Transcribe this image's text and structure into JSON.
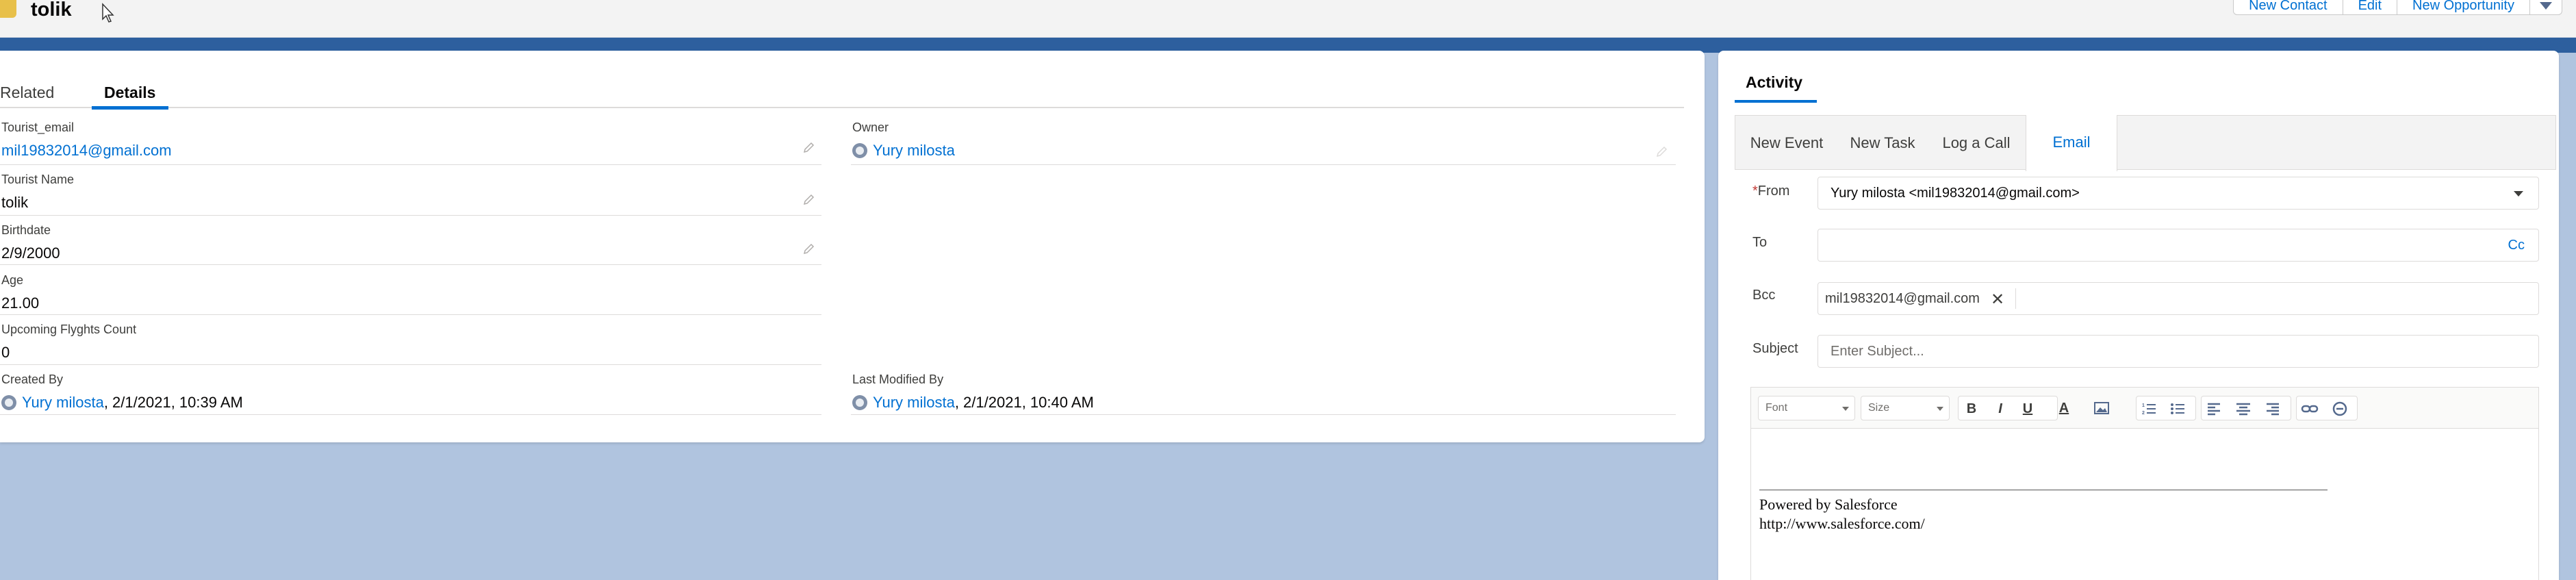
{
  "header": {
    "record_name": "tolik",
    "actions": [
      "New Contact",
      "Edit",
      "New Opportunity"
    ],
    "menu_icon": "chevron-down-icon"
  },
  "detail": {
    "tabs": [
      "Related",
      "Details"
    ],
    "active_tab": "Details",
    "fields": {
      "tourist_email": {
        "label": "Tourist_email",
        "value": "mil19832014@gmail.com"
      },
      "tourist_name": {
        "label": "Tourist Name",
        "value": "tolik"
      },
      "birthdate": {
        "label": "Birthdate",
        "value": "2/9/2000"
      },
      "age": {
        "label": "Age",
        "value": "21.00"
      },
      "upcoming_flights": {
        "label": "Upcoming Flyghts Count",
        "value": "0"
      },
      "owner": {
        "label": "Owner",
        "value": "Yury milosta"
      },
      "created_by": {
        "label": "Created By",
        "user": "Yury milosta",
        "date": ", 2/1/2021, 10:39 AM"
      },
      "last_modified_by": {
        "label": "Last Modified By",
        "user": "Yury milosta",
        "date": ", 2/1/2021, 10:40 AM"
      }
    }
  },
  "activity": {
    "title": "Activity",
    "tabs": [
      "New Event",
      "New Task",
      "Log a Call",
      "Email"
    ],
    "active_tab": "Email",
    "email": {
      "from_label": "From",
      "required_mark": "*",
      "from_value": "Yury milosta <mil19832014@gmail.com>",
      "to_label": "To",
      "cc_label": "Cc",
      "bcc_label": "Bcc",
      "bcc_pill": "mil19832014@gmail.com",
      "subject_label": "Subject",
      "subject_placeholder": "Enter Subject...",
      "font_select": "Font",
      "size_select": "Size",
      "signature_line1": "Powered by Salesforce",
      "signature_line2": "http://www.salesforce.com/"
    }
  },
  "colors": {
    "link": "#0070d2",
    "band": "#2d5f9e",
    "background": "#b0c4df"
  }
}
